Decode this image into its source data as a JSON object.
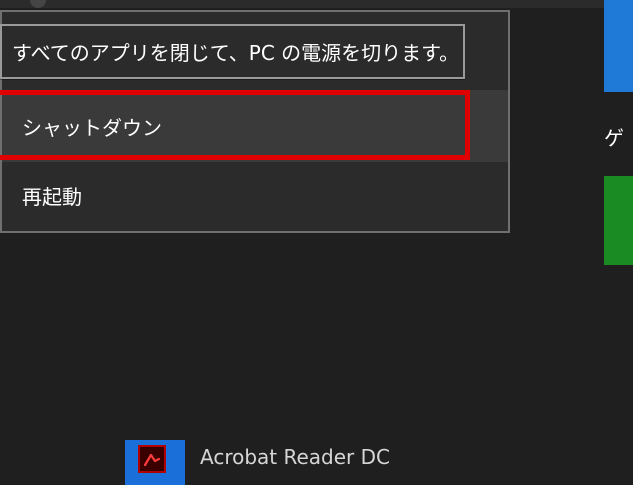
{
  "tooltip": {
    "text": "すべてのアプリを閉じて、PC の電源を切ります。"
  },
  "power_menu": {
    "items": [
      {
        "label": "シャットダウン"
      },
      {
        "label": "再起動"
      }
    ]
  },
  "background": {
    "app_label": "Acrobat Reader DC",
    "partial_right_text": "ゲ"
  },
  "colors": {
    "accent_blue": "#1e7ad6",
    "accent_green": "#1a8a22",
    "annotation_red": "#e00000"
  },
  "icons": {
    "acrobat": "acrobat-reader-icon"
  }
}
